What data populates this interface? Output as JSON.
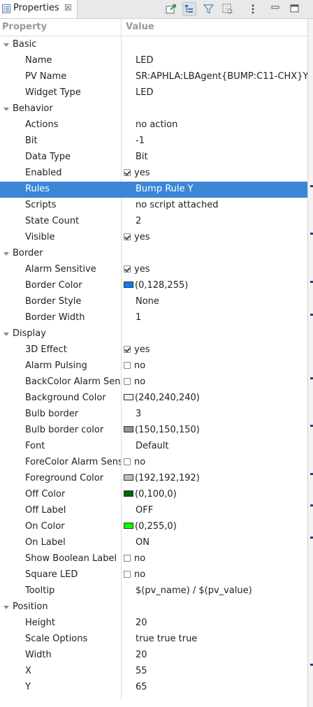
{
  "tab": {
    "title": "Properties",
    "close": "☒"
  },
  "toolbar": {
    "buttons": [
      {
        "name": "pin-editor-icon"
      },
      {
        "name": "show-categories-icon"
      },
      {
        "name": "filter-icon"
      },
      {
        "name": "show-advanced-icon"
      },
      {
        "name": "view-menu-icon"
      },
      {
        "name": "minimize-icon"
      },
      {
        "name": "maximize-icon"
      }
    ]
  },
  "columns": {
    "property": "Property",
    "value": "Value"
  },
  "colors": {
    "selection": "#3b86d6",
    "border_color": "#0080ff",
    "background_color": "#f0f0f0",
    "bulb_border_color": "#969696",
    "foreground_color": "#c0c0c0",
    "off_color": "#006400",
    "on_color": "#00ff00"
  },
  "rows": [
    {
      "type": "category",
      "label": "Basic"
    },
    {
      "label": "Name",
      "value": "LED"
    },
    {
      "label": "PV Name",
      "value": "SR:APHLA:LBAgent{BUMP:C11-CHX}Y"
    },
    {
      "label": "Widget Type",
      "value": "LED"
    },
    {
      "type": "category",
      "label": "Behavior"
    },
    {
      "label": "Actions",
      "value": "no action"
    },
    {
      "label": "Bit",
      "value": "-1"
    },
    {
      "label": "Data Type",
      "value": "Bit"
    },
    {
      "label": "Enabled",
      "value": "yes",
      "checkbox": true,
      "checked": true
    },
    {
      "label": "Rules",
      "value": "Bump Rule Y",
      "selected": true
    },
    {
      "label": "Scripts",
      "value": "no script attached"
    },
    {
      "label": "State Count",
      "value": "2"
    },
    {
      "label": "Visible",
      "value": "yes",
      "checkbox": true,
      "checked": true
    },
    {
      "type": "category",
      "label": "Border"
    },
    {
      "label": "Alarm Sensitive",
      "value": "yes",
      "checkbox": true,
      "checked": true
    },
    {
      "label": "Border Color",
      "value": "(0,128,255)",
      "swatch": "#0080ff"
    },
    {
      "label": "Border Style",
      "value": "None"
    },
    {
      "label": "Border Width",
      "value": "1"
    },
    {
      "type": "category",
      "label": "Display"
    },
    {
      "label": "3D Effect",
      "value": "yes",
      "checkbox": true,
      "checked": true
    },
    {
      "label": "Alarm Pulsing",
      "value": "no",
      "checkbox": true,
      "checked": false
    },
    {
      "label": "BackColor Alarm Sensitive",
      "value": "no",
      "checkbox": true,
      "checked": false
    },
    {
      "label": "Background Color",
      "value": "(240,240,240)",
      "swatch": "#f0f0f0"
    },
    {
      "label": "Bulb border",
      "value": "3"
    },
    {
      "label": "Bulb border color",
      "value": "(150,150,150)",
      "swatch": "#969696"
    },
    {
      "label": "Font",
      "value": "Default"
    },
    {
      "label": "ForeColor Alarm Sensitive",
      "value": "no",
      "checkbox": true,
      "checked": false
    },
    {
      "label": "Foreground Color",
      "value": "(192,192,192)",
      "swatch": "#c0c0c0"
    },
    {
      "label": "Off Color",
      "value": "(0,100,0)",
      "swatch": "#006400"
    },
    {
      "label": "Off Label",
      "value": "OFF"
    },
    {
      "label": "On Color",
      "value": "(0,255,0)",
      "swatch": "#00ff00"
    },
    {
      "label": "On Label",
      "value": "ON"
    },
    {
      "label": "Show Boolean Label",
      "value": "no",
      "checkbox": true,
      "checked": false
    },
    {
      "label": "Square LED",
      "value": "no",
      "checkbox": true,
      "checked": false
    },
    {
      "label": "Tooltip",
      "value": "$(pv_name) / $(pv_value)"
    },
    {
      "type": "category",
      "label": "Position"
    },
    {
      "label": "Height",
      "value": "20"
    },
    {
      "label": "Scale Options",
      "value": "true true true"
    },
    {
      "label": "Width",
      "value": "20"
    },
    {
      "label": "X",
      "value": "55"
    },
    {
      "label": "Y",
      "value": "65"
    }
  ]
}
